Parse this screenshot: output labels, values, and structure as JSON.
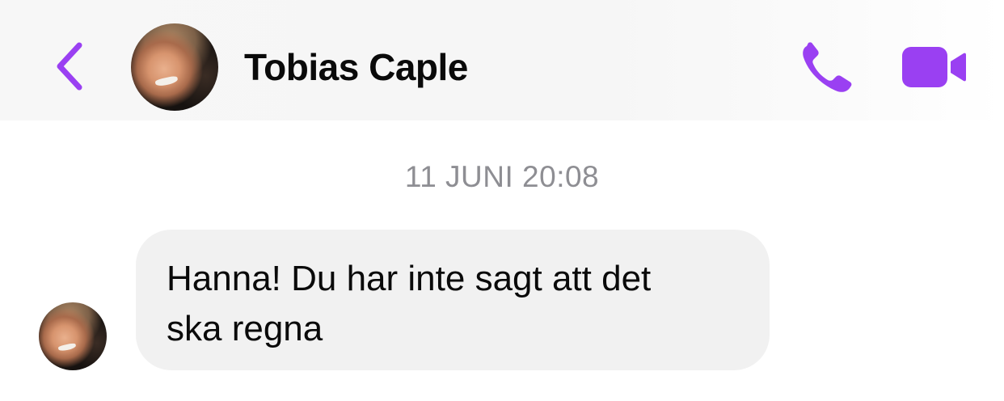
{
  "header": {
    "contact_name": "Tobias Caple",
    "accent_color": "#9a40f2",
    "icons": {
      "back": "chevron-left-icon",
      "call": "phone-icon",
      "video": "video-camera-icon"
    }
  },
  "conversation": {
    "timestamp": "11 JUNI 20:08",
    "messages": [
      {
        "sender": "Tobias Caple",
        "direction": "incoming",
        "text": "Hanna! Du har inte sagt att det\nska regna"
      }
    ]
  }
}
